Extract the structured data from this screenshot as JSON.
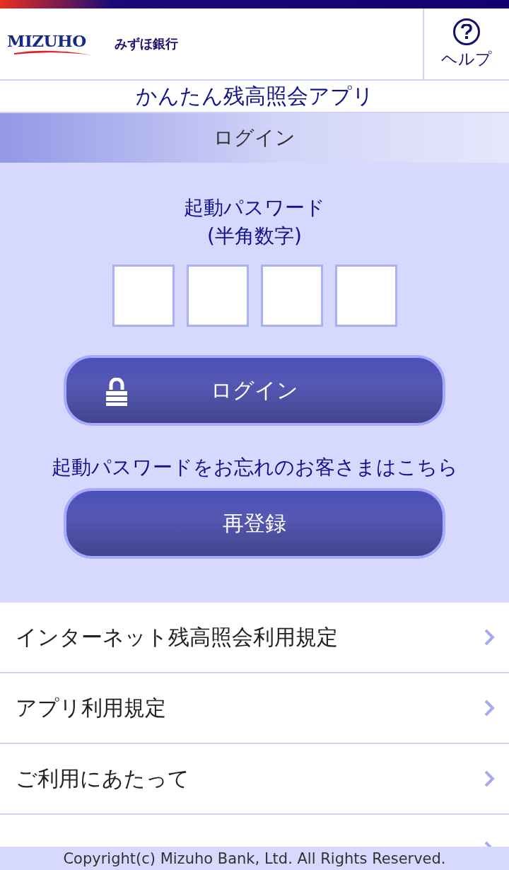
{
  "header": {
    "logo_text": "MIZUHO",
    "bank_name": "みずほ銀行",
    "help_label": "ヘルプ"
  },
  "app_title": "かんたん残高照会アプリ",
  "section_title": "ログイン",
  "password": {
    "label_line1": "起動パスワード",
    "label_line2": "(半角数字)",
    "digits": [
      {
        "filled": false
      },
      {
        "filled": false
      },
      {
        "filled": false
      },
      {
        "filled": false
      }
    ]
  },
  "login_button": "ログイン",
  "forgot_text": "起動パスワードをお忘れのお客さまはこちら",
  "reregister_button": "再登録",
  "menu_items": [
    {
      "kind": "link",
      "label": "インターネット残高照会利用規定"
    },
    {
      "kind": "link",
      "label": "アプリ利用規定"
    },
    {
      "kind": "link",
      "label": "ご利用にあたって"
    },
    {
      "kind": "hidden"
    }
  ],
  "footer": "Copyright(c) Mizuho Bank, Ltd. All Rights Reserved."
}
